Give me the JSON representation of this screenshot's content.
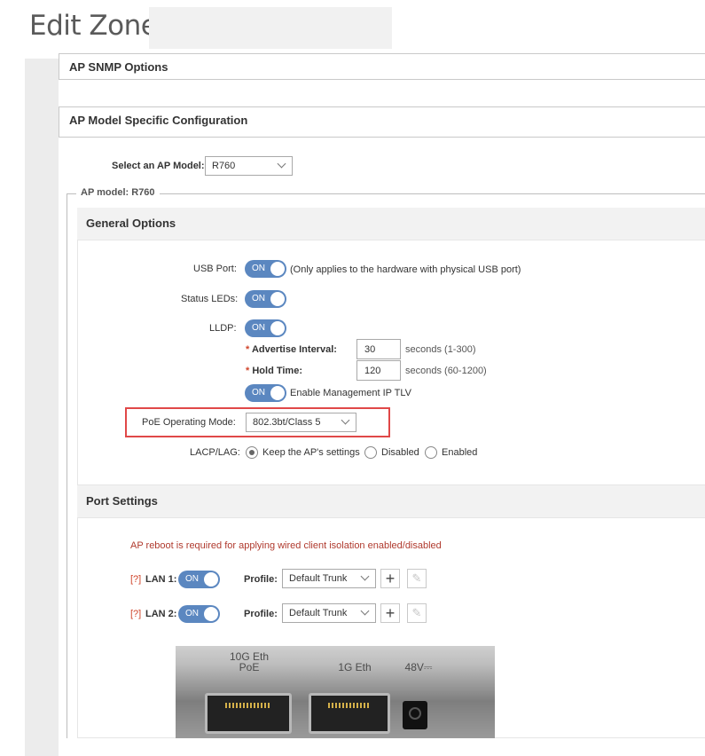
{
  "page": {
    "title": "Edit Zone:"
  },
  "panels": {
    "ap_snmp_options": "AP SNMP Options",
    "ap_model_specific": "AP Model Specific Configuration"
  },
  "model_select": {
    "label": "Select an AP Model:",
    "value": "R760"
  },
  "fieldset_legend": "AP model: R760",
  "general_options": {
    "title": "General Options",
    "usb_port": {
      "label": "USB Port:",
      "toggle": "ON",
      "note": "(Only applies to the hardware with physical USB port)"
    },
    "status_leds": {
      "label": "Status LEDs:",
      "toggle": "ON"
    },
    "lldp": {
      "label": "LLDP:",
      "toggle": "ON",
      "advertise_interval": {
        "label": "Advertise Interval:",
        "value": "30",
        "unit": "seconds (1-300)"
      },
      "hold_time": {
        "label": "Hold Time:",
        "value": "120",
        "unit": "seconds (60-1200)"
      },
      "mgmt_ip_tlv": {
        "toggle": "ON",
        "label": "Enable Management IP TLV"
      }
    },
    "poe": {
      "label": "PoE Operating Mode:",
      "value": "802.3bt/Class 5"
    },
    "lacp": {
      "label": "LACP/LAG:",
      "options": [
        "Keep the AP's settings",
        "Disabled",
        "Enabled"
      ],
      "selected": "Keep the AP's settings"
    }
  },
  "port_settings": {
    "title": "Port Settings",
    "warning": "AP reboot is required for applying wired client isolation enabled/disabled",
    "ports": [
      {
        "help": "[?]",
        "label": "LAN 1:",
        "toggle": "ON",
        "profile_label": "Profile:",
        "profile": "Default Trunk"
      },
      {
        "help": "[?]",
        "label": "LAN 2:",
        "toggle": "ON",
        "profile_label": "Profile:",
        "profile": "Default Trunk"
      }
    ]
  },
  "photo_labels": {
    "port1": "10G Eth\nPoE",
    "port2": "1G Eth",
    "power": "48V⎓"
  },
  "icons": {
    "add": "plus-icon",
    "edit": "pencil-icon"
  },
  "colors": {
    "toggle_on": "#5b87c0",
    "highlight": "#e04848",
    "required": "#d0452b"
  }
}
